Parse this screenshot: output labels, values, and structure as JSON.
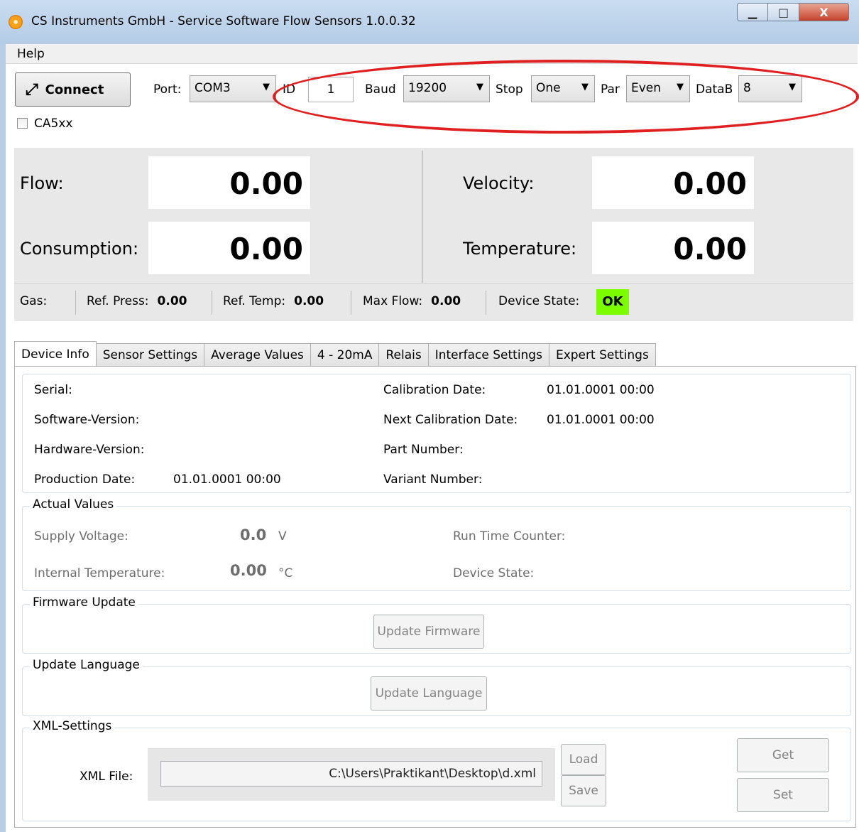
{
  "window": {
    "title": "CS Instruments GmbH - Service Software Flow Sensors  1.0.0.32",
    "min_glyph": "▁",
    "max_glyph": "□",
    "close_glyph": "X"
  },
  "menu": {
    "help": "Help"
  },
  "toolbar": {
    "connect_label": "Connect",
    "port_label": "Port:",
    "port_value": "COM3",
    "id_label": "ID",
    "id_value": "1",
    "baud_label": "Baud",
    "baud_value": "19200",
    "stop_label": "Stop",
    "stop_value": "One",
    "par_label": "Par",
    "par_value": "Even",
    "datab_label": "DataB",
    "datab_value": "8",
    "ca5xx_label": "CA5xx",
    "arrow_glyph": "▼"
  },
  "values": {
    "flow_label": "Flow:",
    "flow_value": "0.00",
    "consumption_label": "Consumption:",
    "consumption_value": "0.00",
    "velocity_label": "Velocity:",
    "velocity_value": "0.00",
    "temperature_label": "Temperature:",
    "temperature_value": "0.00"
  },
  "status": {
    "gas_label": "Gas:",
    "ref_press_label": "Ref. Press:",
    "ref_press_value": "0.00",
    "ref_temp_label": "Ref. Temp:",
    "ref_temp_value": "0.00",
    "max_flow_label": "Max Flow:",
    "max_flow_value": "0.00",
    "device_state_label": "Device State:",
    "device_state_value": "OK",
    "ok_color": "#7cfc00"
  },
  "tabs": [
    "Device Info",
    "Sensor Settings",
    "Average Values",
    "4 - 20mA",
    "Relais",
    "Interface Settings",
    "Expert Settings"
  ],
  "device_info": {
    "serial_label": "Serial:",
    "software_label": "Software-Version:",
    "hardware_label": "Hardware-Version:",
    "production_label": "Production Date:",
    "production_value": "01.01.0001 00:00",
    "calibration_label": "Calibration Date:",
    "calibration_value": "01.01.0001 00:00",
    "next_calibration_label": "Next Calibration Date:",
    "next_calibration_value": "01.01.0001 00:00",
    "part_number_label": "Part Number:",
    "variant_number_label": "Variant Number:"
  },
  "actual_values": {
    "title": "Actual Values",
    "supply_label": "Supply Voltage:",
    "supply_value": "0.0",
    "supply_unit": "V",
    "internal_temp_label": "Internal Temperature:",
    "internal_temp_value": "0.00",
    "internal_temp_unit": "°C",
    "run_time_label": "Run Time Counter:",
    "device_state_label": "Device State:"
  },
  "firmware": {
    "title": "Firmware Update",
    "button": "Update Firmware"
  },
  "language": {
    "title": "Update Language",
    "button": "Update Language"
  },
  "xml": {
    "title": "XML-Settings",
    "file_label": "XML File:",
    "file_value": "C:\\Users\\Praktikant\\Desktop\\d.xml",
    "load": "Load",
    "save": "Save",
    "get": "Get",
    "set": "Set"
  }
}
